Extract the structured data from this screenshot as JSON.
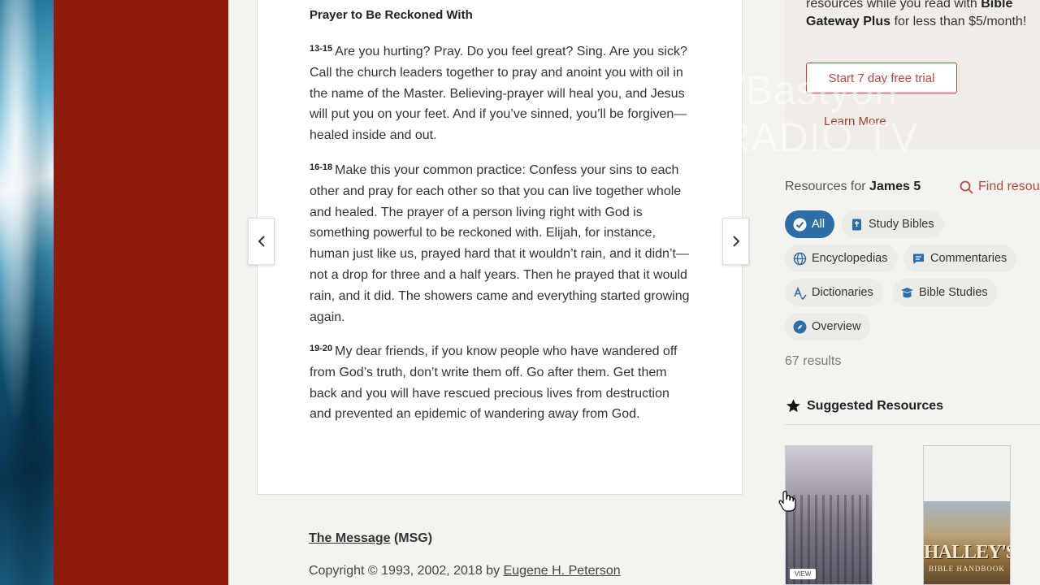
{
  "passage": {
    "section_heading": "Prayer to Be Reckoned With",
    "verses": [
      {
        "num": "13-15",
        "text": "Are you hurting? Pray. Do you feel great? Sing. Are you sick? Call the church leaders together to pray and anoint you with oil in the name of the Master. Believing-prayer will heal you, and Jesus will put you on your feet. And if you’ve sinned, you’ll be forgiven—healed inside and out."
      },
      {
        "num": "16-18",
        "text": "Make this your common practice: Confess your sins to each other and pray for each other so that you can live together whole and healed. The prayer of a person living right with God is something powerful to be reckoned with. Elijah, for instance, human just like us, prayed hard that it wouldn’t rain, and it didn’t—not a drop for three and a half years. Then he prayed that it would rain, and it did. The showers came and everything started growing again."
      },
      {
        "num": "19-20",
        "text": "My dear friends, if you know people who have wandered off from God’s truth, don’t write them off. Go after them. Get them back and you will have rescued precious lives from destruction and prevented an epidemic of wandering away from God."
      }
    ],
    "prev_icon": "chevron-left-icon",
    "next_icon": "chevron-right-icon"
  },
  "version": {
    "name": "The Message",
    "abbr": "(MSG)",
    "copyright_prefix": "Copyright © 1993, 2002, 2018 by",
    "author": "Eugene H. Peterson"
  },
  "plus": {
    "text_line1": "resources while you read with",
    "text_bold": "Bible Gateway Plus",
    "text_line2": "for less than $5/month!",
    "trial_button": "Start 7 day free trial",
    "learn_more": "Learn More"
  },
  "resources": {
    "title_prefix": "Resources for",
    "title_book": "James 5",
    "find_label": "Find resou",
    "chips": {
      "all": "All",
      "study_bibles": "Study Bibles",
      "encyclopedias": "Encyclopedias",
      "commentaries": "Commentaries",
      "dictionaries": "Dictionaries",
      "bible_studies": "Bible Studies",
      "overview": "Overview"
    },
    "results": "67 results",
    "suggested_title": "Suggested Resources",
    "view_tag": "VIEW",
    "book2_title": "HALLEY'S",
    "book2_sub": "BIBLE HANDBOOK"
  },
  "watermark": {
    "line1": "S+/Bastyon",
    "line2": "E RADIO TV"
  },
  "colors": {
    "accent_red": "#b24a3c",
    "active_chip": "#2e6ea6",
    "sidebar_red": "#8e1b0c"
  }
}
